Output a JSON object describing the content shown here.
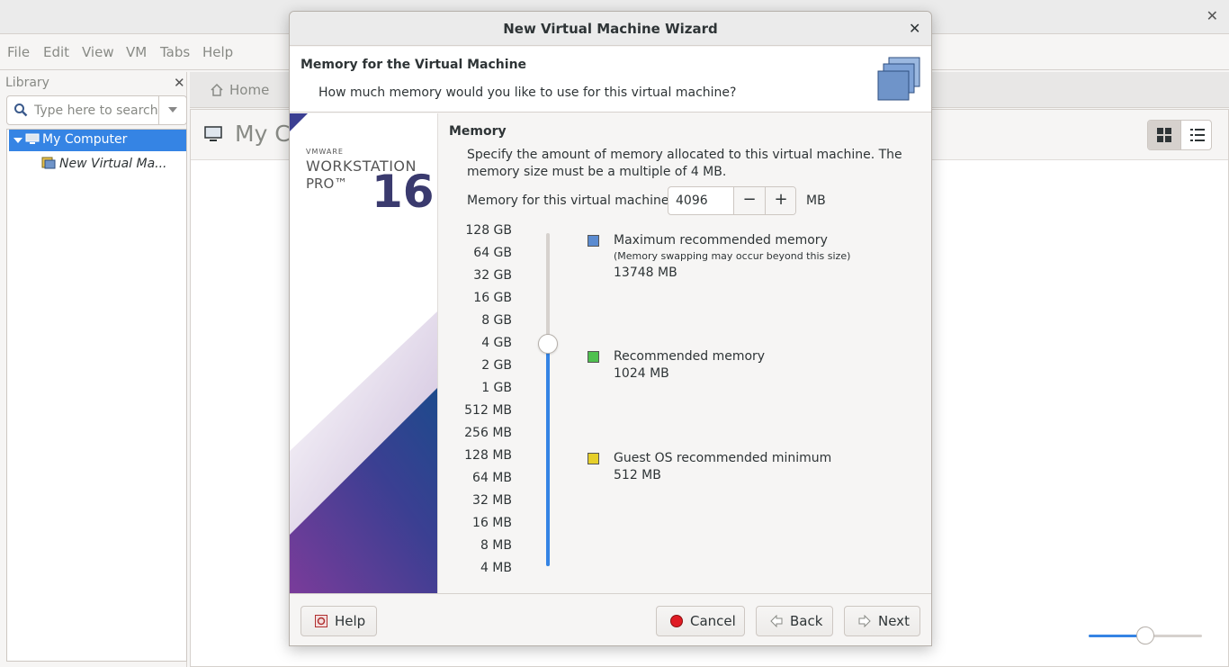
{
  "app": {
    "menu": [
      "File",
      "Edit",
      "View",
      "VM",
      "Tabs",
      "Help"
    ],
    "library": {
      "title": "Library",
      "search_placeholder": "Type here to search",
      "tree": {
        "root": "My Computer",
        "child": "New Virtual Ma..."
      }
    },
    "tabs": {
      "home": "Home"
    },
    "page_title": "My Co",
    "zoom_level": 0.5
  },
  "dialog": {
    "title": "New Virtual Machine Wizard",
    "header_title": "Memory for the Virtual Machine",
    "header_subtitle": "How much memory would you like to use for this virtual machine?",
    "branding": {
      "vendor": "VMWARE",
      "product": "WORKSTATION",
      "edition": "PRO™",
      "version": "16"
    },
    "section_title": "Memory",
    "description": "Specify the amount of memory allocated to this virtual machine. The memory size must be a multiple of 4 MB.",
    "memory_label": "Memory for this virtual machine:",
    "memory_value": "4096",
    "memory_unit": "MB",
    "scale": [
      "128 GB",
      "64 GB",
      "32 GB",
      "16 GB",
      "8 GB",
      "4 GB",
      "2 GB",
      "1 GB",
      "512 MB",
      "256 MB",
      "128 MB",
      "64 MB",
      "32 MB",
      "16 MB",
      "8 MB",
      "4 MB"
    ],
    "slider_selected_index": 5,
    "legend": {
      "max": {
        "label": "Maximum recommended memory",
        "note": "(Memory swapping may occur beyond this size)",
        "value": "13748 MB",
        "color": "#5b8bd0"
      },
      "recommended": {
        "label": "Recommended memory",
        "value": "1024 MB",
        "color": "#4fc04f"
      },
      "minimum": {
        "label": "Guest OS recommended minimum",
        "value": "512 MB",
        "color": "#e6cf2a"
      }
    },
    "buttons": {
      "help": "Help",
      "cancel": "Cancel",
      "back": "Back",
      "next": "Next"
    }
  },
  "colors": {
    "accent": "#3584e4",
    "selection": "#3584e4"
  }
}
